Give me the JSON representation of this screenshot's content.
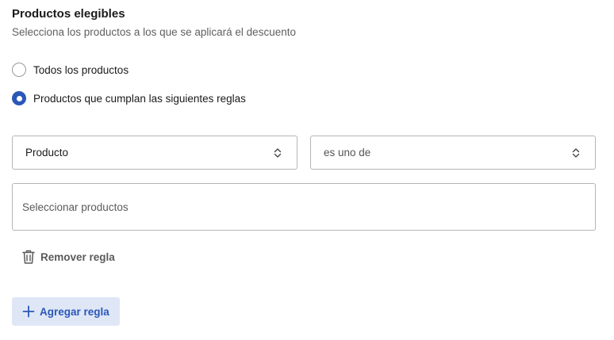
{
  "section": {
    "title": "Productos elegibles",
    "subtitle": "Selecciona los productos a los que se aplicará el descuento"
  },
  "options": [
    {
      "label": "Todos los productos",
      "selected": false
    },
    {
      "label": "Productos que cumplan las siguientes reglas",
      "selected": true
    }
  ],
  "rule": {
    "field_select": {
      "value": "Producto",
      "icon": "chevron-up-down-icon"
    },
    "operator_select": {
      "value": "es uno de",
      "icon": "chevron-up-down-icon"
    },
    "products_input": {
      "placeholder": "Seleccionar productos"
    },
    "remove_button": {
      "label": "Remover regla",
      "icon": "trash-icon"
    }
  },
  "add_button": {
    "label": "Agregar regla",
    "icon": "plus-icon"
  },
  "colors": {
    "accent": "#2b57b7",
    "accent_light_bg": "#dfe7f7",
    "border": "#b5b5b5",
    "muted_text": "#5a5a5a"
  }
}
